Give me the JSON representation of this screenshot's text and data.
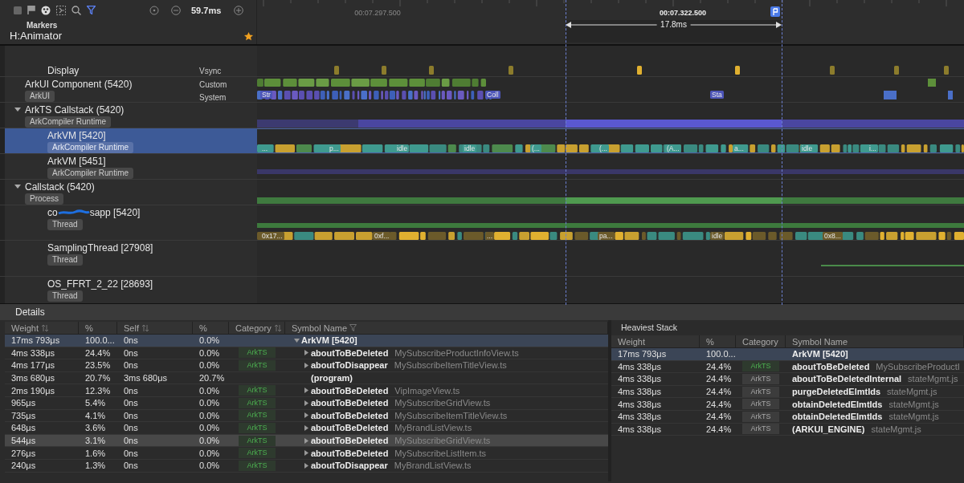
{
  "toolbar": {
    "duration": "59.7ms"
  },
  "ruler": {
    "ticks": [
      {
        "label": "00:07.297.500",
        "selected": false
      },
      {
        "label": "00:07.322.500",
        "selected": true
      }
    ],
    "range": "17.8ms"
  },
  "markers": {
    "title": "Markers",
    "name": "H:Animator",
    "starred": true
  },
  "tracks": [
    {
      "name": "Display",
      "kind": "vsync",
      "right_labels": [
        "Vsync"
      ],
      "selected": false
    },
    {
      "name": "ArkUI Component (5420)",
      "kind": "component",
      "tag": "ArkUI",
      "right_labels": [
        "Custom",
        "System"
      ],
      "slice_labels": [
        "Str",
        "Coll",
        "Sta"
      ],
      "selected": false
    },
    {
      "name": "ArkTS Callstack (5420)",
      "kind": "summary",
      "tag": "ArkCompiler Runtime",
      "expanded": true,
      "selected": false,
      "children": [
        {
          "name": "ArkVM [5420]",
          "kind": "slices",
          "tag": "ArkCompiler Runtime",
          "selected": true,
          "slice_labels": [
            "...",
            "p...",
            "idle",
            "idle",
            "(...",
            "(...",
            "(A...",
            "a...",
            "idle",
            "i..."
          ]
        },
        {
          "name": "ArkVM [5451]",
          "kind": "flat",
          "tag": "ArkCompiler Runtime",
          "selected": false
        }
      ]
    },
    {
      "name": "Callstack (5420)",
      "kind": "green",
      "tag": "Process",
      "expanded": true,
      "selected": false,
      "children": [
        {
          "name": "co",
          "name_suffix": "sapp [5420]",
          "kind": "thread",
          "tag": "Thread",
          "selected": false,
          "slice_labels": [
            "0x17...",
            "0xf...",
            "...",
            "pa...",
            "idle",
            "0x8..."
          ]
        },
        {
          "name": "SamplingThread [27908]",
          "kind": "sampling",
          "tag": "Thread",
          "selected": false
        },
        {
          "name": "OS_FFRT_2_22 [28693]",
          "kind": "empty",
          "tag": "Thread",
          "selected": false
        }
      ]
    }
  ],
  "details": {
    "title": "Details",
    "columns": [
      {
        "label": "Weight"
      },
      {
        "label": "%"
      },
      {
        "label": "Self"
      },
      {
        "label": "%"
      },
      {
        "label": "Category"
      },
      {
        "label": "Symbol Name"
      }
    ],
    "rows": [
      {
        "weight": "17ms 793μs",
        "pct": "100.0...",
        "self": "0ns",
        "self_pct": "0.0%",
        "symbol": "ArkVM [5420]",
        "kind": "frame",
        "expanded": true,
        "selected": true,
        "children": [
          {
            "weight": "4ms 338μs",
            "pct": "24.4%",
            "self": "0ns",
            "self_pct": "0.0%",
            "category": "ArkTS",
            "symbol": "aboutToBeDeleted",
            "file": "MySubscribeProductInfoView.ts",
            "kind": "frame",
            "selected": false,
            "hovered": false
          },
          {
            "weight": "4ms 177μs",
            "pct": "23.5%",
            "self": "0ns",
            "self_pct": "0.0%",
            "category": "ArkTS",
            "symbol": "aboutToDisappear",
            "file": "MySubscribeItemTitleView.ts",
            "kind": "frame",
            "selected": false,
            "hovered": false
          },
          {
            "weight": "3ms 680μs",
            "pct": "20.7%",
            "self": "3ms 680μs",
            "self_pct": "20.7%",
            "symbol": "(program)",
            "kind": "leaf",
            "selected": false,
            "hovered": false
          },
          {
            "weight": "2ms 190μs",
            "pct": "12.3%",
            "self": "0ns",
            "self_pct": "0.0%",
            "category": "ArkTS",
            "symbol": "aboutToBeDeleted",
            "file": "VipImageView.ts",
            "kind": "frame",
            "selected": false,
            "hovered": false
          },
          {
            "weight": "965μs",
            "pct": "5.4%",
            "self": "0ns",
            "self_pct": "0.0%",
            "category": "ArkTS",
            "symbol": "aboutToBeDeleted",
            "file": "MySubscribeGridView.ts",
            "kind": "frame",
            "selected": false,
            "hovered": false
          },
          {
            "weight": "735μs",
            "pct": "4.1%",
            "self": "0ns",
            "self_pct": "0.0%",
            "category": "ArkTS",
            "symbol": "aboutToBeDeleted",
            "file": "MySubscribeItemTitleView.ts",
            "kind": "frame",
            "selected": false,
            "hovered": false
          },
          {
            "weight": "648μs",
            "pct": "3.6%",
            "self": "0ns",
            "self_pct": "0.0%",
            "category": "ArkTS",
            "symbol": "aboutToBeDeleted",
            "file": "MyBrandListView.ts",
            "kind": "frame",
            "selected": false,
            "hovered": false
          },
          {
            "weight": "544μs",
            "pct": "3.1%",
            "self": "0ns",
            "self_pct": "0.0%",
            "category": "ArkTS",
            "symbol": "aboutToBeDeleted",
            "file": "MySubscribeGridView.ts",
            "kind": "frame",
            "selected": false,
            "hovered": true
          },
          {
            "weight": "276μs",
            "pct": "1.6%",
            "self": "0ns",
            "self_pct": "0.0%",
            "category": "ArkTS",
            "symbol": "aboutToBeDeleted",
            "file": "MySubscribeListItem.ts",
            "kind": "frame",
            "selected": false,
            "hovered": false
          },
          {
            "weight": "240μs",
            "pct": "1.3%",
            "self": "0ns",
            "self_pct": "0.0%",
            "category": "ArkTS",
            "symbol": "aboutToDisappear",
            "file": "MyBrandListView.ts",
            "kind": "frame",
            "selected": false,
            "hovered": false
          }
        ]
      }
    ]
  },
  "heaviest": {
    "title": "Heaviest Stack",
    "columns": [
      {
        "label": "Weight"
      },
      {
        "label": "%"
      },
      {
        "label": "Category"
      },
      {
        "label": "Symbol Name"
      }
    ],
    "rows": [
      {
        "weight": "17ms 793μs",
        "pct": "100.0...",
        "symbol": "ArkVM [5420]",
        "selected": true
      },
      {
        "weight": "4ms 338μs",
        "pct": "24.4%",
        "category": "ArkTS",
        "highlighted": true,
        "symbol": "aboutToBeDeleted",
        "file": "MySubscribeProductI",
        "selected": false
      },
      {
        "weight": "4ms 338μs",
        "pct": "24.4%",
        "category": "ArkTS",
        "highlighted": false,
        "symbol": "aboutToBeDeletedInternal",
        "file": "stateMgmt.js",
        "selected": false
      },
      {
        "weight": "4ms 338μs",
        "pct": "24.4%",
        "category": "ArkTS",
        "highlighted": false,
        "symbol": "purgeDeletedElmtIds",
        "file": "stateMgmt.js",
        "selected": false
      },
      {
        "weight": "4ms 338μs",
        "pct": "24.4%",
        "category": "ArkTS",
        "highlighted": false,
        "symbol": "obtainDeletedElmtIds",
        "file": "stateMgmt.js",
        "selected": false
      },
      {
        "weight": "4ms 338μs",
        "pct": "24.4%",
        "category": "ArkTS",
        "highlighted": false,
        "symbol": "obtainDeletedElmtIds",
        "file": "stateMgmt.js",
        "selected": false
      },
      {
        "weight": "4ms 338μs",
        "pct": "24.4%",
        "category": "ArkTS",
        "highlighted": false,
        "symbol": "(ARKUI_ENGINE)",
        "file": "stateMgmt.js",
        "selected": false
      }
    ]
  }
}
